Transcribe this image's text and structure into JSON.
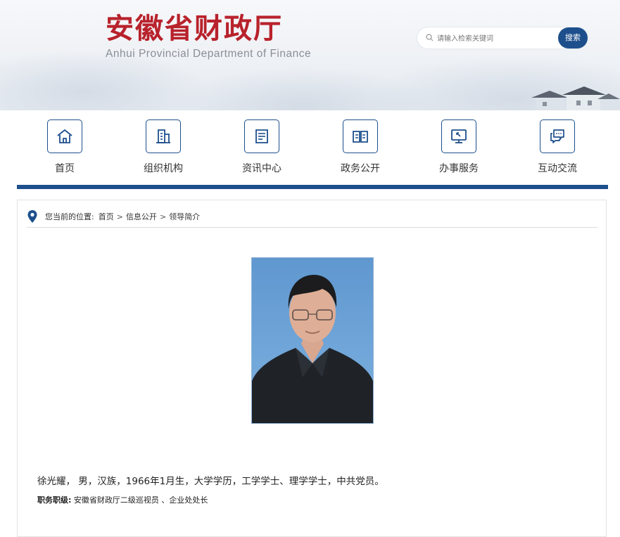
{
  "header": {
    "title": "安徽省财政厅",
    "subtitle": "Anhui Provincial Department of Finance",
    "search": {
      "placeholder": "请输入检索关键词",
      "button": "搜索"
    }
  },
  "nav": [
    {
      "label": "首页",
      "icon": "home-icon"
    },
    {
      "label": "组织机构",
      "icon": "building-icon"
    },
    {
      "label": "资讯中心",
      "icon": "news-icon"
    },
    {
      "label": "政务公开",
      "icon": "book-icon"
    },
    {
      "label": "办事服务",
      "icon": "monitor-icon"
    },
    {
      "label": "互动交流",
      "icon": "chat-icon"
    }
  ],
  "breadcrumb": {
    "prefix": "您当前的位置:",
    "items": [
      "首页",
      "信息公开",
      "领导简介"
    ],
    "separator": ">"
  },
  "profile": {
    "bio": "徐光耀，  男，汉族，1966年1月生，大学学历，工学学士、理学学士，中共党员。",
    "duty_label": "职务职级:",
    "duty_value": "安徽省财政厅二级巡视员 、企业处处长"
  },
  "colors": {
    "brand_red": "#b8222c",
    "brand_blue": "#1d4f8c"
  }
}
